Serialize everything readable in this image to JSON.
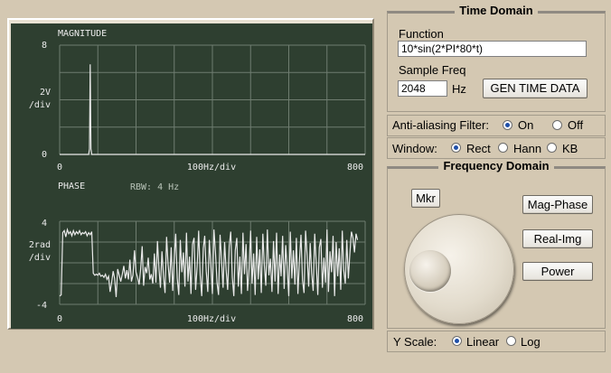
{
  "scope": {
    "magnitude_plot": {
      "title": "MAGNITUDE",
      "y_top": "8",
      "y_bottom": "0",
      "y_div_1": "2V",
      "y_div_2": "/div",
      "x_left": "0",
      "x_mid": "100Hz/div",
      "x_right": "800"
    },
    "phase_plot": {
      "title": "PHASE",
      "rbw": "RBW: 4 Hz",
      "y_top": "4",
      "y_bottom": "-4",
      "y_div_1": "2rad",
      "y_div_2": "/div",
      "x_left": "0",
      "x_mid": "100Hz/div",
      "x_right": "800"
    }
  },
  "chart_data": [
    {
      "type": "line",
      "title": "MAGNITUDE",
      "xlabel": "100Hz/div",
      "ylabel": "2V /div",
      "xlim": [
        0,
        800
      ],
      "ylim": [
        0,
        8
      ],
      "grid": true,
      "x": [
        0,
        76,
        78,
        80,
        82,
        84,
        800
      ],
      "values": [
        0,
        0,
        0.4,
        6.6,
        0.4,
        0,
        0
      ]
    },
    {
      "type": "line",
      "title": "PHASE",
      "subtitle": "RBW: 4 Hz",
      "xlabel": "100Hz/div",
      "ylabel": "2rad /div",
      "xlim": [
        0,
        800
      ],
      "ylim": [
        -4,
        4
      ],
      "grid": true,
      "x": [
        0,
        4,
        8,
        12,
        16,
        20,
        24,
        28,
        32,
        36,
        40,
        44,
        48,
        52,
        56,
        60,
        64,
        68,
        72,
        76,
        80,
        84,
        88,
        92,
        96,
        100,
        104,
        108,
        112,
        116,
        120,
        124,
        128,
        132,
        136,
        140,
        144,
        148,
        152,
        156,
        160,
        164,
        168,
        172,
        176,
        180,
        184,
        188,
        192,
        196,
        200,
        204,
        208,
        212,
        216,
        220,
        224,
        228,
        232,
        236,
        240,
        244,
        248,
        252,
        256,
        260,
        264,
        268,
        272,
        276,
        280,
        284,
        288,
        292,
        296,
        300,
        304,
        308,
        312,
        316,
        320,
        324,
        328,
        332,
        336,
        340,
        344,
        348,
        352,
        356,
        360,
        364,
        368,
        372,
        376,
        380,
        384,
        388,
        392,
        396,
        400,
        404,
        408,
        412,
        416,
        420,
        424,
        428,
        432,
        436,
        440,
        444,
        448,
        452,
        456,
        460,
        464,
        468,
        472,
        476,
        480,
        484,
        488,
        492,
        496,
        500,
        504,
        508,
        512,
        516,
        520,
        524,
        528,
        532,
        536,
        540,
        544,
        548,
        552,
        556,
        560,
        564,
        568,
        572,
        576,
        580,
        584,
        588,
        592,
        596,
        600,
        604,
        608,
        612,
        616,
        620,
        624,
        628,
        632,
        636,
        640,
        644,
        648,
        652,
        656,
        660,
        664,
        668,
        672,
        676,
        680,
        684,
        688,
        692,
        696,
        700,
        704,
        708,
        712,
        716,
        720,
        724,
        728,
        732,
        736,
        740,
        744,
        748,
        752,
        756,
        760,
        764,
        768,
        772,
        776,
        780,
        784,
        788,
        792,
        796,
        800
      ],
      "values": [
        -3.2,
        -3.1,
        2.9,
        3.1,
        2.5,
        3.2,
        2.8,
        3.0,
        2.6,
        3.1,
        2.7,
        3.0,
        2.8,
        3.1,
        2.7,
        2.9,
        2.8,
        3.0,
        2.6,
        2.9,
        2.7,
        3.0,
        -1.0,
        -1.2,
        -1.1,
        -1.2,
        -1.0,
        -1.3,
        -1.2,
        -1.4,
        -1.1,
        -1.6,
        -1.3,
        -2.8,
        -1.9,
        -0.8,
        -1.5,
        -3.3,
        -0.6,
        -1.2,
        -1.8,
        -1.1,
        -0.3,
        -1.5,
        -0.7,
        -1.6,
        0.3,
        -1.8,
        -1.2,
        1.2,
        -0.9,
        -1.4,
        -2.1,
        -0.6,
        1.6,
        -2.2,
        -0.4,
        -1.0,
        0.5,
        -1.6,
        -1.1,
        -2.0,
        0.9,
        -1.9,
        2.1,
        -0.6,
        -2.4,
        1.1,
        -1.3,
        -2.9,
        2.5,
        -0.2,
        -1.9,
        1.5,
        -2.7,
        0.4,
        2.8,
        -1.5,
        -3.1,
        2.2,
        -0.9,
        1.0,
        -2.3,
        2.9,
        -1.8,
        0.6,
        -3.0,
        1.8,
        2.4,
        -2.6,
        -0.4,
        3.1,
        -1.2,
        -3.2,
        1.4,
        2.6,
        -0.8,
        -2.8,
        2.2,
        -0.2,
        -3.0,
        3.2,
        1.0,
        -1.9,
        -3.1,
        2.7,
        0.3,
        -2.4,
        2.0,
        -0.7,
        -2.6,
        1.6,
        3.0,
        -1.4,
        -3.2,
        1.2,
        2.4,
        -2.3,
        0.6,
        -3.0,
        2.9,
        -1.1,
        1.8,
        -2.7,
        -0.5,
        3.1,
        -2.0,
        0.9,
        -3.1,
        2.5,
        -1.6,
        1.3,
        -2.9,
        2.8,
        -0.3,
        -2.2,
        3.2,
        -1.2,
        0.4,
        -2.8,
        2.1,
        -1.8,
        2.9,
        -3.0,
        0.8,
        -1.3,
        2.6,
        -2.5,
        1.7,
        -0.6,
        -3.2,
        3.0,
        -1.5,
        1.2,
        -2.1,
        2.4,
        -3.0,
        0.2,
        2.7,
        -1.7,
        -2.9,
        3.1,
        0.7,
        -2.3,
        1.9,
        -1.0,
        -2.7,
        2.8,
        -0.1,
        -3.1,
        1.5,
        2.3,
        -2.4,
        0.5,
        -1.9,
        3.2,
        -2.8,
        1.1,
        -0.9,
        2.6,
        -3.2,
        2.0,
        -1.3,
        1.4,
        -2.6,
        3.1,
        -0.7,
        -2.0,
        2.2,
        -1.5,
        0.9,
        3.0,
        2.4,
        1.0,
        2.8,
        2.2
      ]
    }
  ],
  "time_domain": {
    "title": "Time Domain",
    "function_label": "Function",
    "function_value": "10*sin(2*PI*80*t)",
    "sample_freq_label": "Sample Freq",
    "sample_freq_value": "2048",
    "sample_freq_unit": "Hz",
    "gen_button": "GEN TIME DATA"
  },
  "anti_aliasing": {
    "label": "Anti-aliasing Filter:",
    "options": [
      "On",
      "Off"
    ],
    "selected": "On"
  },
  "window": {
    "label": "Window:",
    "options": [
      "Rect",
      "Hann",
      "KB"
    ],
    "selected": "Rect"
  },
  "frequency_domain": {
    "title": "Frequency Domain",
    "mkr_button": "Mkr",
    "mag_phase_button": "Mag-Phase",
    "real_img_button": "Real-Img",
    "power_button": "Power"
  },
  "y_scale": {
    "label": "Y Scale:",
    "options": [
      "Linear",
      "Log"
    ],
    "selected": "Linear"
  },
  "colors": {
    "scope_bg": "#2e3f30",
    "grid": "#6f7d70",
    "trace": "#eaeaea",
    "panel_bg": "#d4c8b2",
    "radio_dot": "#1f4fa8"
  }
}
